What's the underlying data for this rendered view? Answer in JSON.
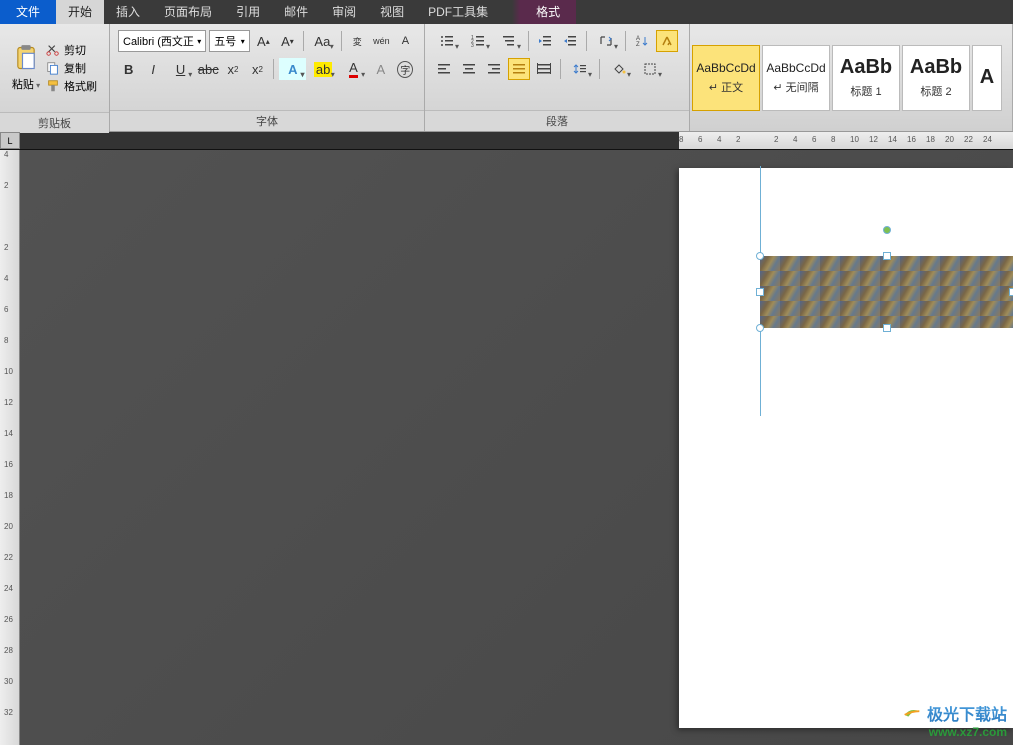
{
  "menu": {
    "file": "文件",
    "home": "开始",
    "insert": "插入",
    "layout": "页面布局",
    "references": "引用",
    "mail": "邮件",
    "review": "审阅",
    "view": "视图",
    "pdf": "PDF工具集",
    "format": "格式"
  },
  "clipboard": {
    "paste": "粘贴",
    "cut": "剪切",
    "copy": "复制",
    "formatPainter": "格式刷",
    "group": "剪贴板"
  },
  "font": {
    "name": "Calibri (西文正",
    "size": "五号",
    "group": "字体"
  },
  "paragraph": {
    "group": "段落"
  },
  "styles": [
    {
      "sample": "AaBbCcDd",
      "name": "↵ 正文",
      "big": false,
      "active": true
    },
    {
      "sample": "AaBbCcDd",
      "name": "↵ 无间隔",
      "big": false,
      "active": false
    },
    {
      "sample": "AaBb",
      "name": "标题 1",
      "big": true,
      "active": false
    },
    {
      "sample": "AaBb",
      "name": "标题 2",
      "big": true,
      "active": false
    },
    {
      "sample": "A",
      "name": "",
      "big": true,
      "active": false
    }
  ],
  "ruler_h": [
    "8",
    "6",
    "4",
    "2",
    "",
    "2",
    "4",
    "6",
    "8",
    "10",
    "12",
    "14",
    "16",
    "18",
    "20",
    "22",
    "24"
  ],
  "ruler_v": [
    "4",
    "2",
    "",
    "2",
    "4",
    "6",
    "8",
    "10",
    "12",
    "14",
    "16",
    "18",
    "20",
    "22",
    "24",
    "26",
    "28",
    "30",
    "32"
  ],
  "watermark": {
    "title": "极光下载站",
    "url": "www.xz7.com"
  }
}
